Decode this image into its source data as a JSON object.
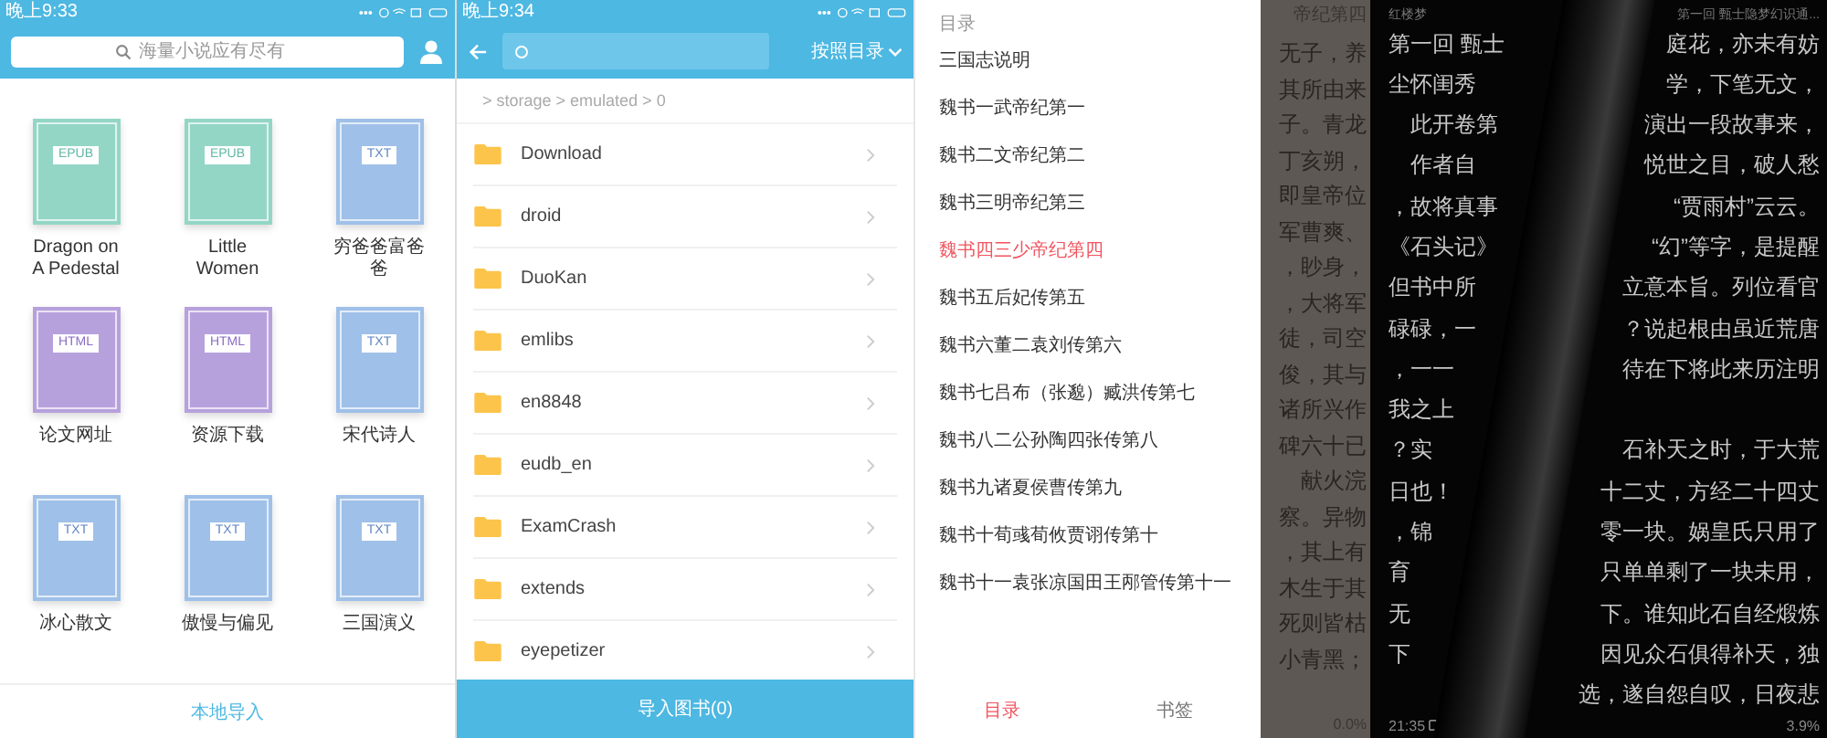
{
  "library": {
    "status_time": "晚上9:33",
    "search": {
      "placeholder": "海量小说应有尽有"
    },
    "books": [
      {
        "kind": "epub",
        "format": "EPUB",
        "title": "Dragon on A Pedestal"
      },
      {
        "kind": "epub",
        "format": "EPUB",
        "title": "Little Women"
      },
      {
        "kind": "txt",
        "format": "TXT",
        "title": "穷爸爸富爸爸"
      },
      {
        "kind": "html",
        "format": "HTML",
        "title": "论文网址"
      },
      {
        "kind": "html",
        "format": "HTML",
        "title": "资源下载"
      },
      {
        "kind": "txt",
        "format": "TXT",
        "title": "宋代诗人"
      },
      {
        "kind": "txt",
        "format": "TXT",
        "title": "冰心散文"
      },
      {
        "kind": "txt",
        "format": "TXT",
        "title": "傲慢与偏见"
      },
      {
        "kind": "txt",
        "format": "TXT",
        "title": "三国演义"
      }
    ],
    "import_button": "本地导入"
  },
  "file_browser": {
    "status_time": "晚上9:34",
    "sort_menu": "按照目录",
    "breadcrumb": "> storage > emulated > 0",
    "folders": [
      "Download",
      "droid",
      "DuoKan",
      "emlibs",
      "en8848",
      "eudb_en",
      "ExamCrash",
      "extends",
      "eyepetizer"
    ],
    "import_button": "导入图书(0)"
  },
  "toc": {
    "heading": "目录",
    "chapters": [
      {
        "title": "三国志说明",
        "selected": false
      },
      {
        "title": "魏书一武帝纪第一",
        "selected": false
      },
      {
        "title": "魏书二文帝纪第二",
        "selected": false
      },
      {
        "title": "魏书三明帝纪第三",
        "selected": false
      },
      {
        "title": "魏书四三少帝纪第四",
        "selected": true
      },
      {
        "title": "魏书五后妃传第五",
        "selected": false
      },
      {
        "title": "魏书六董二袁刘传第六",
        "selected": false
      },
      {
        "title": "魏书七吕布（张邈）臧洪传第七",
        "selected": false
      },
      {
        "title": "魏书八二公孙陶四张传第八",
        "selected": false
      },
      {
        "title": "魏书九诸夏侯曹传第九",
        "selected": false
      },
      {
        "title": "魏书十荀彧荀攸贾诩传第十",
        "selected": false
      },
      {
        "title": "魏书十一袁张凉国田王邴管传第十一",
        "selected": false
      }
    ],
    "tabs": [
      {
        "label": "目录",
        "selected": true
      },
      {
        "label": "书签",
        "selected": false
      }
    ]
  },
  "reader": {
    "prev_page": {
      "header": "帝纪第四",
      "lines": [
        "无子，养",
        "其所由来",
        "子。青龙",
        "丁亥朔，",
        "即皇帝位",
        "军曹爽、",
        "，眇身，",
        "，大将军",
        "徒，司空",
        "俊，其与",
        "诸所兴作",
        "碑六十已",
        "献火浣",
        "察。异物",
        "，其上有",
        "木生于其",
        "死则皆枯",
        "小青黑；"
      ],
      "progress": "0.0%"
    },
    "page": {
      "book_title": "红楼梦",
      "chapter": "第一回 甄士隐梦幻识通...",
      "lines": [
        {
          "left": "第一回 甄士",
          "right": "庭花，亦未有妨"
        },
        {
          "left": "尘怀闺秀",
          "right": "学，下笔无文，"
        },
        {
          "left": "　此开卷第",
          "right": "演出一段故事来，"
        },
        {
          "left": "　作者自",
          "right": "悦世之目，破人愁"
        },
        {
          "left": "，故将真事",
          "right": "“贾雨村”云云。"
        },
        {
          "left": "《石头记》",
          "right": "“幻”等字，是提醒"
        },
        {
          "left": "但书中所",
          "right": "立意本旨。列位看官"
        },
        {
          "left": "碌碌，一",
          "right": "？说起根由虽近荒唐"
        },
        {
          "left": "，一一",
          "right": "待在下将此来历注明"
        },
        {
          "left": "我之上"
        },
        {
          "left": "？实",
          "right": "石补天之时，于大荒"
        },
        {
          "left": "日也！",
          "right": "十二丈，方经二十四丈"
        },
        {
          "left": "，锦",
          "right": "零一块。娲皇氏只用了"
        },
        {
          "left": "育",
          "right": "只单单剩了一块未用，"
        },
        {
          "left": "无",
          "right": "下。谁知此石自经煅炼"
        },
        {
          "left": "下",
          "right": "因见众石俱得补天，独"
        },
        {
          "right": "选，遂自怨自叹，日夜悲"
        }
      ],
      "time": "21:35",
      "progress": "3.9%"
    }
  }
}
